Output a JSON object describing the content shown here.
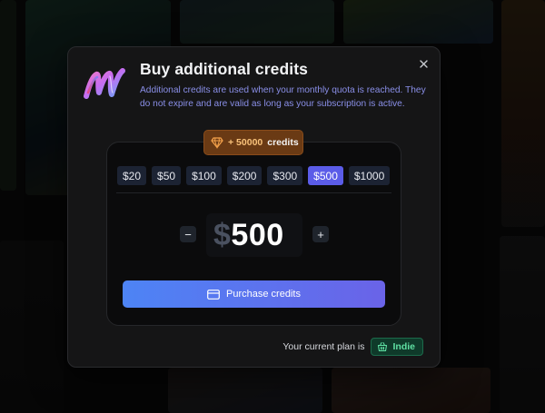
{
  "modal": {
    "title": "Buy additional credits",
    "description": "Additional credits are used when your monthly quota is reached. They do not expire and are valid as long as your subscription is active.",
    "close_icon": "close-icon",
    "logo_icon": "brand-m-logo"
  },
  "credits_badge": {
    "icon": "diamond-icon",
    "amount": "+ 50000",
    "label": "credits"
  },
  "amount_options": [
    "$20",
    "$50",
    "$100",
    "$200",
    "$300",
    "$500",
    "$1000"
  ],
  "selected_amount": "$500",
  "stepper": {
    "decrement_label": "−",
    "increment_label": "+"
  },
  "price": {
    "currency": "$",
    "value": "500"
  },
  "purchase_button": {
    "icon": "credit-card-icon",
    "label": "Purchase credits"
  },
  "plan": {
    "prefix": "Your current plan is",
    "name": "Indie",
    "icon": "basket-icon"
  },
  "colors": {
    "accent_selected": "#5b5ce8",
    "button_gradient_start": "#4d84f5",
    "button_gradient_end": "#6a63e8",
    "badge_orange": "#6a3a14",
    "plan_green": "#5fe0a3"
  }
}
